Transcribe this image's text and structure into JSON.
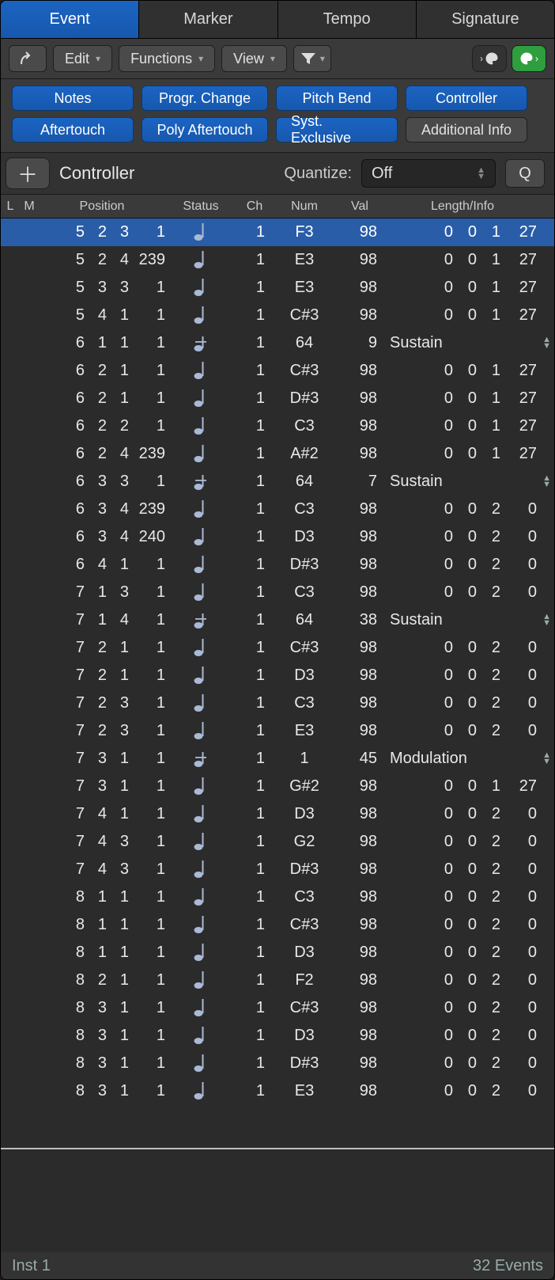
{
  "tabs": {
    "event": "Event",
    "marker": "Marker",
    "tempo": "Tempo",
    "signature": "Signature"
  },
  "toolbar": {
    "edit": "Edit",
    "functions": "Functions",
    "view": "View"
  },
  "filters": {
    "notes": "Notes",
    "progr_change": "Progr. Change",
    "pitch_bend": "Pitch Bend",
    "controller": "Controller",
    "aftertouch": "Aftertouch",
    "poly_aftertouch": "Poly Aftertouch",
    "syst_exclusive": "Syst. Exclusive",
    "additional_info": "Additional Info"
  },
  "create": {
    "type": "Controller",
    "quantize_label": "Quantize:",
    "quantize_value": "Off",
    "q_button": "Q"
  },
  "headers": {
    "l": "L",
    "m": "M",
    "position": "Position",
    "status": "Status",
    "ch": "Ch",
    "num": "Num",
    "val": "Val",
    "length": "Length/Info"
  },
  "footer": {
    "track": "Inst 1",
    "count": "32 Events"
  },
  "events": [
    {
      "selected": true,
      "pos": [
        "5",
        "2",
        "3",
        "1"
      ],
      "status": "note",
      "ch": "1",
      "num": "F3",
      "val": "98",
      "len": [
        "0",
        "0",
        "1",
        "27"
      ]
    },
    {
      "pos": [
        "5",
        "2",
        "4",
        "239"
      ],
      "status": "note",
      "ch": "1",
      "num": "E3",
      "val": "98",
      "len": [
        "0",
        "0",
        "1",
        "27"
      ]
    },
    {
      "pos": [
        "5",
        "3",
        "3",
        "1"
      ],
      "status": "note",
      "ch": "1",
      "num": "E3",
      "val": "98",
      "len": [
        "0",
        "0",
        "1",
        "27"
      ]
    },
    {
      "pos": [
        "5",
        "4",
        "1",
        "1"
      ],
      "status": "note",
      "ch": "1",
      "num": "C#3",
      "val": "98",
      "len": [
        "0",
        "0",
        "1",
        "27"
      ]
    },
    {
      "pos": [
        "6",
        "1",
        "1",
        "1"
      ],
      "status": "ctrl",
      "ch": "1",
      "num": "64",
      "val": "9",
      "info": "Sustain"
    },
    {
      "pos": [
        "6",
        "2",
        "1",
        "1"
      ],
      "status": "note",
      "ch": "1",
      "num": "C#3",
      "val": "98",
      "len": [
        "0",
        "0",
        "1",
        "27"
      ]
    },
    {
      "pos": [
        "6",
        "2",
        "1",
        "1"
      ],
      "status": "note",
      "ch": "1",
      "num": "D#3",
      "val": "98",
      "len": [
        "0",
        "0",
        "1",
        "27"
      ]
    },
    {
      "pos": [
        "6",
        "2",
        "2",
        "1"
      ],
      "status": "note",
      "ch": "1",
      "num": "C3",
      "val": "98",
      "len": [
        "0",
        "0",
        "1",
        "27"
      ]
    },
    {
      "pos": [
        "6",
        "2",
        "4",
        "239"
      ],
      "status": "note",
      "ch": "1",
      "num": "A#2",
      "val": "98",
      "len": [
        "0",
        "0",
        "1",
        "27"
      ]
    },
    {
      "pos": [
        "6",
        "3",
        "3",
        "1"
      ],
      "status": "ctrl",
      "ch": "1",
      "num": "64",
      "val": "7",
      "info": "Sustain"
    },
    {
      "pos": [
        "6",
        "3",
        "4",
        "239"
      ],
      "status": "note",
      "ch": "1",
      "num": "C3",
      "val": "98",
      "len": [
        "0",
        "0",
        "2",
        "0"
      ]
    },
    {
      "pos": [
        "6",
        "3",
        "4",
        "240"
      ],
      "status": "note",
      "ch": "1",
      "num": "D3",
      "val": "98",
      "len": [
        "0",
        "0",
        "2",
        "0"
      ]
    },
    {
      "pos": [
        "6",
        "4",
        "1",
        "1"
      ],
      "status": "note",
      "ch": "1",
      "num": "D#3",
      "val": "98",
      "len": [
        "0",
        "0",
        "2",
        "0"
      ]
    },
    {
      "pos": [
        "7",
        "1",
        "3",
        "1"
      ],
      "status": "note",
      "ch": "1",
      "num": "C3",
      "val": "98",
      "len": [
        "0",
        "0",
        "2",
        "0"
      ]
    },
    {
      "pos": [
        "7",
        "1",
        "4",
        "1"
      ],
      "status": "ctrl",
      "ch": "1",
      "num": "64",
      "val": "38",
      "info": "Sustain"
    },
    {
      "pos": [
        "7",
        "2",
        "1",
        "1"
      ],
      "status": "note",
      "ch": "1",
      "num": "C#3",
      "val": "98",
      "len": [
        "0",
        "0",
        "2",
        "0"
      ]
    },
    {
      "pos": [
        "7",
        "2",
        "1",
        "1"
      ],
      "status": "note",
      "ch": "1",
      "num": "D3",
      "val": "98",
      "len": [
        "0",
        "0",
        "2",
        "0"
      ]
    },
    {
      "pos": [
        "7",
        "2",
        "3",
        "1"
      ],
      "status": "note",
      "ch": "1",
      "num": "C3",
      "val": "98",
      "len": [
        "0",
        "0",
        "2",
        "0"
      ]
    },
    {
      "pos": [
        "7",
        "2",
        "3",
        "1"
      ],
      "status": "note",
      "ch": "1",
      "num": "E3",
      "val": "98",
      "len": [
        "0",
        "0",
        "2",
        "0"
      ]
    },
    {
      "pos": [
        "7",
        "3",
        "1",
        "1"
      ],
      "status": "ctrl",
      "ch": "1",
      "num": "1",
      "val": "45",
      "info": "Modulation"
    },
    {
      "pos": [
        "7",
        "3",
        "1",
        "1"
      ],
      "status": "note",
      "ch": "1",
      "num": "G#2",
      "val": "98",
      "len": [
        "0",
        "0",
        "1",
        "27"
      ]
    },
    {
      "pos": [
        "7",
        "4",
        "1",
        "1"
      ],
      "status": "note",
      "ch": "1",
      "num": "D3",
      "val": "98",
      "len": [
        "0",
        "0",
        "2",
        "0"
      ]
    },
    {
      "pos": [
        "7",
        "4",
        "3",
        "1"
      ],
      "status": "note",
      "ch": "1",
      "num": "G2",
      "val": "98",
      "len": [
        "0",
        "0",
        "2",
        "0"
      ]
    },
    {
      "pos": [
        "7",
        "4",
        "3",
        "1"
      ],
      "status": "note",
      "ch": "1",
      "num": "D#3",
      "val": "98",
      "len": [
        "0",
        "0",
        "2",
        "0"
      ]
    },
    {
      "pos": [
        "8",
        "1",
        "1",
        "1"
      ],
      "status": "note",
      "ch": "1",
      "num": "C3",
      "val": "98",
      "len": [
        "0",
        "0",
        "2",
        "0"
      ]
    },
    {
      "pos": [
        "8",
        "1",
        "1",
        "1"
      ],
      "status": "note",
      "ch": "1",
      "num": "C#3",
      "val": "98",
      "len": [
        "0",
        "0",
        "2",
        "0"
      ]
    },
    {
      "pos": [
        "8",
        "1",
        "1",
        "1"
      ],
      "status": "note",
      "ch": "1",
      "num": "D3",
      "val": "98",
      "len": [
        "0",
        "0",
        "2",
        "0"
      ]
    },
    {
      "pos": [
        "8",
        "2",
        "1",
        "1"
      ],
      "status": "note",
      "ch": "1",
      "num": "F2",
      "val": "98",
      "len": [
        "0",
        "0",
        "2",
        "0"
      ]
    },
    {
      "pos": [
        "8",
        "3",
        "1",
        "1"
      ],
      "status": "note",
      "ch": "1",
      "num": "C#3",
      "val": "98",
      "len": [
        "0",
        "0",
        "2",
        "0"
      ]
    },
    {
      "pos": [
        "8",
        "3",
        "1",
        "1"
      ],
      "status": "note",
      "ch": "1",
      "num": "D3",
      "val": "98",
      "len": [
        "0",
        "0",
        "2",
        "0"
      ]
    },
    {
      "pos": [
        "8",
        "3",
        "1",
        "1"
      ],
      "status": "note",
      "ch": "1",
      "num": "D#3",
      "val": "98",
      "len": [
        "0",
        "0",
        "2",
        "0"
      ]
    },
    {
      "pos": [
        "8",
        "3",
        "1",
        "1"
      ],
      "status": "note",
      "ch": "1",
      "num": "E3",
      "val": "98",
      "len": [
        "0",
        "0",
        "2",
        "0"
      ]
    }
  ]
}
